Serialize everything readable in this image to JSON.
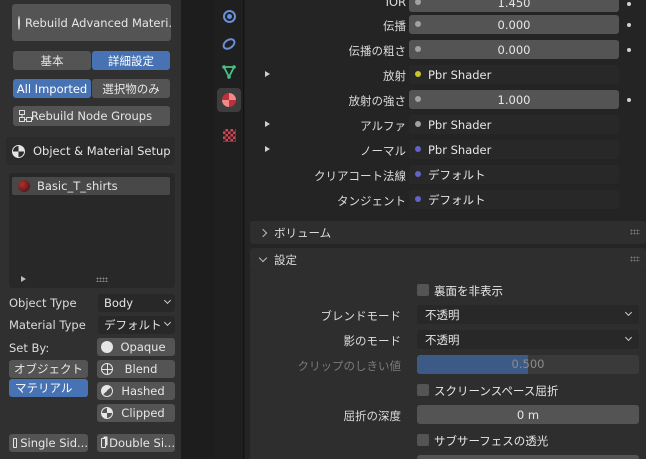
{
  "left": {
    "rebuild_materials": "Rebuild Advanced Materi...",
    "tabs": [
      "基本",
      "詳細設定"
    ],
    "scope": [
      "All Imported",
      "選択物のみ"
    ],
    "rebuild_node_groups": "Rebuild Node Groups",
    "object_material_setup": "Object & Material Setup",
    "material_list": [
      {
        "name": "Basic_T_shirts"
      }
    ],
    "object_type": {
      "label": "Object Type",
      "value": "Body"
    },
    "material_type": {
      "label": "Material Type",
      "value": "デフォルト"
    },
    "set_by": {
      "label": "Set By:",
      "options": [
        "オブジェクト",
        "マテリアル"
      ]
    },
    "blend_options": [
      "Opaque",
      "Blend",
      "Hashed",
      "Clipped"
    ],
    "single_side": "Single Sid...",
    "double_side": "Double Si..."
  },
  "right": {
    "rows": [
      {
        "label": "IOR",
        "value": "1.450",
        "type": "number"
      },
      {
        "label": "伝播",
        "value": "0.000",
        "type": "number"
      },
      {
        "label": "伝播の粗さ",
        "value": "0.000",
        "type": "number"
      },
      {
        "label": "放射",
        "value": "Pbr Shader",
        "type": "link"
      },
      {
        "label": "放射の強さ",
        "value": "1.000",
        "type": "number"
      },
      {
        "label": "アルファ",
        "value": "Pbr Shader",
        "type": "link"
      },
      {
        "label": "ノーマル",
        "value": "Pbr Shader",
        "type": "link"
      },
      {
        "label": "クリアコート法線",
        "value": "デフォルト",
        "type": "vector"
      },
      {
        "label": "タンジェント",
        "value": "デフォルト",
        "type": "vector"
      }
    ],
    "volume_header": "ボリューム",
    "settings_header": "設定",
    "backface_culling": "裏面を非表示",
    "blend_mode": {
      "label": "ブレンドモード",
      "value": "不透明"
    },
    "shadow_mode": {
      "label": "影のモード",
      "value": "不透明"
    },
    "clip_threshold": {
      "label": "クリップのしきい値",
      "value": "0.500"
    },
    "screen_space_refraction": "スクリーンスペース屈折",
    "refraction_depth": {
      "label": "屈折の深度",
      "value": "0 m"
    },
    "subsurface_translucency": "サブサーフェスの透光"
  },
  "colors": {
    "accent": "#4772b3",
    "panel": "#303030",
    "props_bg": "#242424",
    "field": "#545454"
  }
}
